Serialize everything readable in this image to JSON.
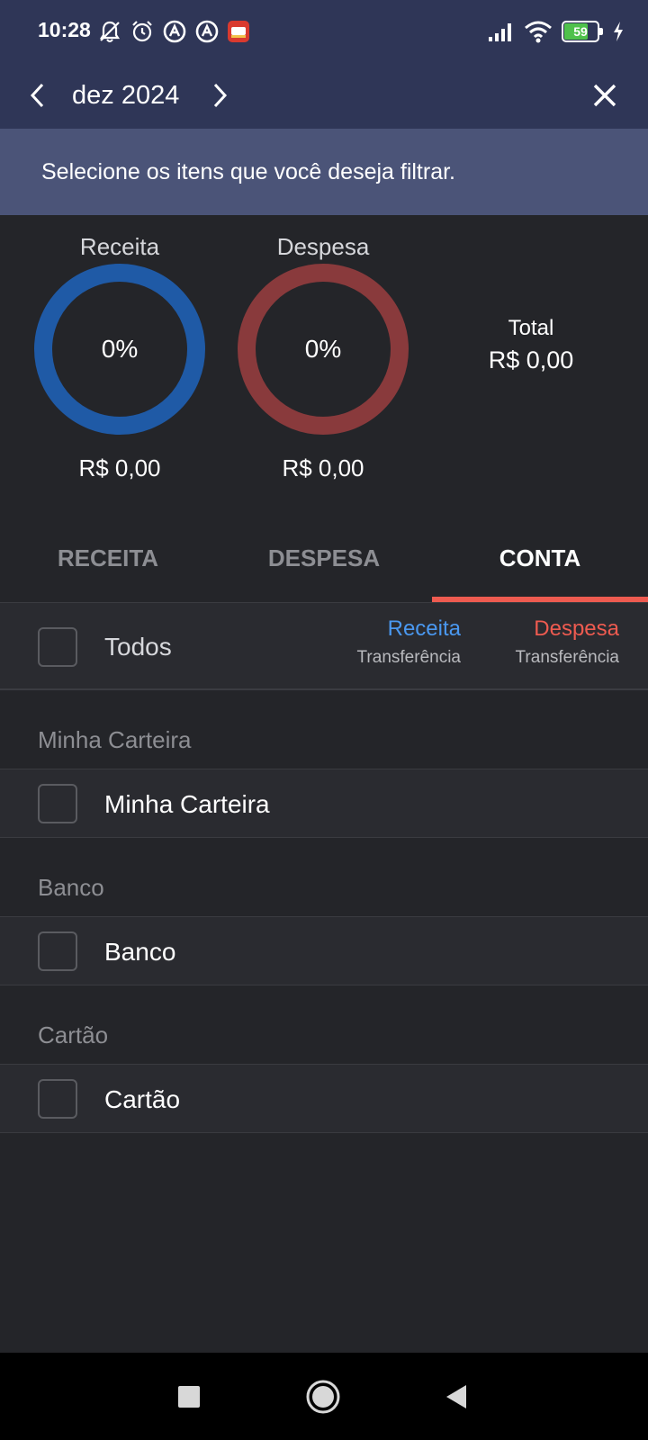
{
  "status_bar": {
    "time": "10:28",
    "left_icons": [
      "bell-off-icon",
      "alarm-icon",
      "circle-a-icon",
      "circle-a-icon",
      "app-notification-icon"
    ],
    "battery_level": "59",
    "right_icons": [
      "signal-icon",
      "wifi-icon",
      "battery-icon",
      "charging-icon"
    ]
  },
  "header": {
    "month": "dez 2024",
    "prev_icon": "chevron-left-icon",
    "next_icon": "chevron-right-icon",
    "close_icon": "close-icon"
  },
  "banner": {
    "text": "Selecione os itens que você deseja filtrar."
  },
  "summary": {
    "receita": {
      "label": "Receita",
      "percent": "0%",
      "value": "R$ 0,00",
      "color": "#1f5aa6"
    },
    "despesa": {
      "label": "Despesa",
      "percent": "0%",
      "value": "R$ 0,00",
      "color": "#893a3c"
    },
    "total": {
      "label": "Total",
      "value": "R$ 0,00"
    }
  },
  "tabs": [
    {
      "label": "RECEITA",
      "active": false
    },
    {
      "label": "DESPESA",
      "active": false
    },
    {
      "label": "CONTA",
      "active": true
    }
  ],
  "todos_row": {
    "label": "Todos",
    "receita_head": "Receita",
    "receita_sub": "Transferência",
    "despesa_head": "Despesa",
    "despesa_sub": "Transferência",
    "receita_color": "#4a98f0",
    "despesa_color": "#ee5b50"
  },
  "groups": [
    {
      "title": "Minha Carteira",
      "items": [
        {
          "label": "Minha Carteira",
          "checked": false
        }
      ]
    },
    {
      "title": "Banco",
      "items": [
        {
          "label": "Banco",
          "checked": false
        }
      ]
    },
    {
      "title": "Cartão",
      "items": [
        {
          "label": "Cartão",
          "checked": false
        }
      ]
    }
  ],
  "nav_bar": {
    "icons": [
      "recents-square-icon",
      "home-circle-icon",
      "back-triangle-icon"
    ]
  }
}
